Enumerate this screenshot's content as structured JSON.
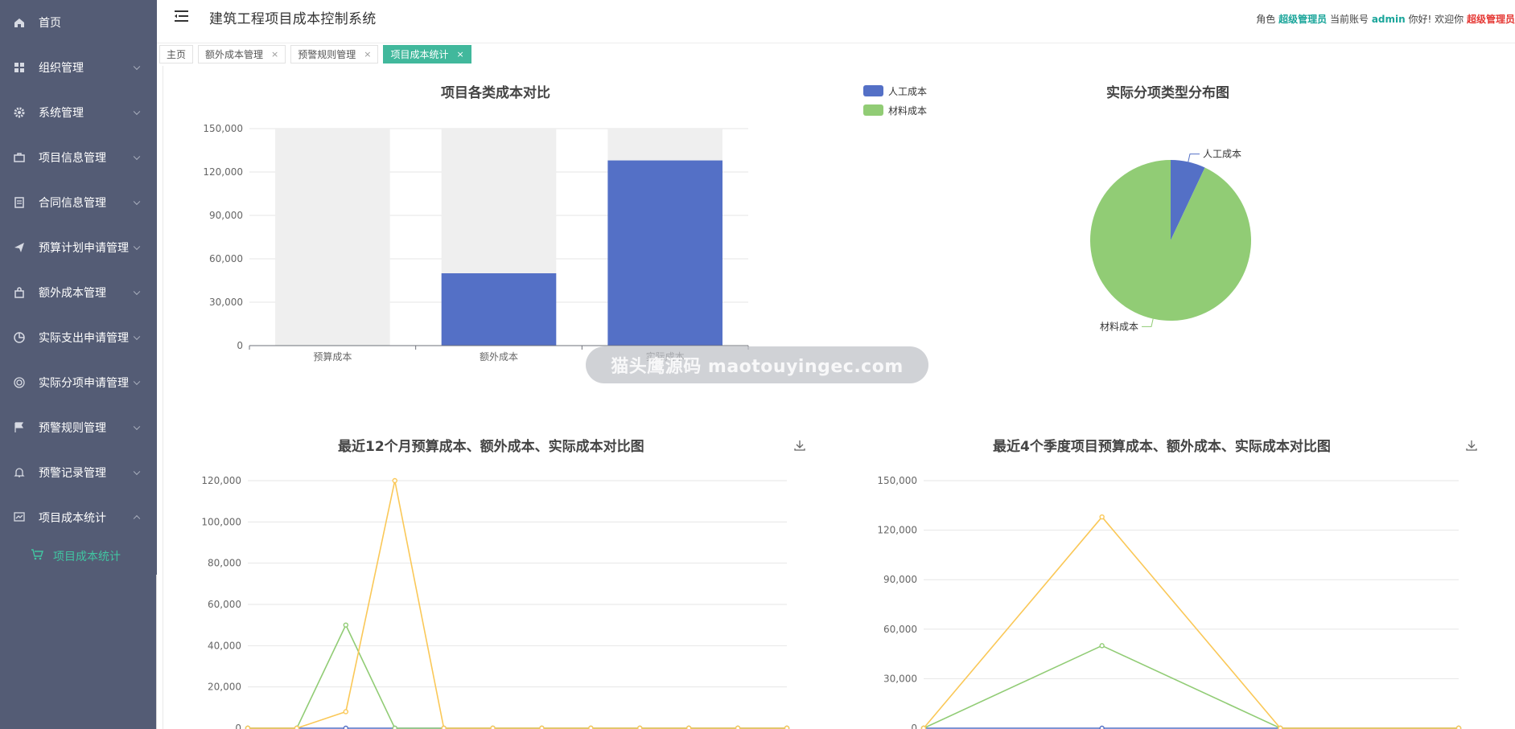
{
  "app": {
    "title": "建筑工程项目成本控制系统",
    "role_label": "角色",
    "role": "超级管理员",
    "account_label": "当前账号",
    "account": "admin",
    "greeting": "你好! 欢迎你",
    "welcome_name": "超级管理员"
  },
  "sidebar": {
    "items": [
      {
        "label": "首页",
        "icon": "home-icon"
      },
      {
        "label": "组织管理",
        "icon": "grid-icon"
      },
      {
        "label": "系统管理",
        "icon": "gear-icon"
      },
      {
        "label": "项目信息管理",
        "icon": "briefcase-icon"
      },
      {
        "label": "合同信息管理",
        "icon": "contract-icon"
      },
      {
        "label": "预算计划申请管理",
        "icon": "paper-plane-icon"
      },
      {
        "label": "额外成本管理",
        "icon": "bag-icon"
      },
      {
        "label": "实际支出申请管理",
        "icon": "pie-icon"
      },
      {
        "label": "实际分项申请管理",
        "icon": "target-icon"
      },
      {
        "label": "预警规则管理",
        "icon": "flag-icon"
      },
      {
        "label": "预警记录管理",
        "icon": "bell-icon"
      },
      {
        "label": "项目成本统计",
        "icon": "stats-icon"
      }
    ],
    "sub_item": {
      "label": "项目成本统计",
      "icon": "cart-icon"
    }
  },
  "tabs": [
    {
      "label": "主页",
      "closable": false,
      "active": false
    },
    {
      "label": "额外成本管理",
      "closable": true,
      "active": false
    },
    {
      "label": "预警规则管理",
      "closable": true,
      "active": false
    },
    {
      "label": "项目成本统计",
      "closable": true,
      "active": true
    }
  ],
  "tab_close_glyph": "×",
  "watermark": "猫头鹰源码 maotouyingec.com",
  "colors": {
    "sidebar_bg": "#545c75",
    "accent": "#41b89c",
    "blue": "#5470c6",
    "green": "#91cc75",
    "yellow": "#fac858"
  },
  "chart_data": [
    {
      "type": "bar",
      "title": "项目各类成本对比",
      "categories": [
        "预算成本",
        "额外成本",
        "实际成本"
      ],
      "series": [
        {
          "name": "人工成本",
          "color": "#5470c6",
          "values": [
            0,
            50000,
            128000
          ]
        },
        {
          "name": "材料成本",
          "color": "#91cc75",
          "values": [
            0,
            0,
            0
          ]
        }
      ],
      "background_bars": true,
      "ylim": [
        0,
        150000
      ],
      "yticks": [
        "0",
        "30,000",
        "60,000",
        "90,000",
        "120,000",
        "150,000"
      ],
      "legend": "top-right"
    },
    {
      "type": "pie",
      "title": "实际分项类型分布图",
      "slices": [
        {
          "name": "人工成本",
          "color": "#5470c6",
          "value": 7
        },
        {
          "name": "材料成本",
          "color": "#91cc75",
          "value": 93
        }
      ]
    },
    {
      "type": "line",
      "title": "最近12个月预算成本、额外成本、实际成本对比图",
      "x_count": 12,
      "ylim": [
        0,
        120000
      ],
      "yticks": [
        "0",
        "20,000",
        "40,000",
        "60,000",
        "80,000",
        "100,000",
        "120,000"
      ],
      "series": [
        {
          "color": "#5470c6",
          "values": [
            0,
            0,
            0,
            0,
            0,
            0,
            0,
            0,
            0,
            0,
            0,
            0
          ]
        },
        {
          "color": "#91cc75",
          "values": [
            0,
            0,
            50000,
            0,
            0,
            0,
            0,
            0,
            0,
            0,
            0,
            0
          ]
        },
        {
          "color": "#fac858",
          "values": [
            0,
            0,
            8000,
            120000,
            0,
            0,
            0,
            0,
            0,
            0,
            0,
            0
          ]
        }
      ]
    },
    {
      "type": "line",
      "title": "最近4个季度项目预算成本、额外成本、实际成本对比图",
      "x_count": 4,
      "ylim": [
        0,
        150000
      ],
      "yticks": [
        "0",
        "30,000",
        "60,000",
        "90,000",
        "120,000",
        "150,000"
      ],
      "series": [
        {
          "color": "#5470c6",
          "values": [
            0,
            0,
            0,
            0
          ]
        },
        {
          "color": "#91cc75",
          "values": [
            0,
            50000,
            0,
            0
          ]
        },
        {
          "color": "#fac858",
          "values": [
            0,
            128000,
            0,
            0
          ]
        }
      ]
    }
  ]
}
